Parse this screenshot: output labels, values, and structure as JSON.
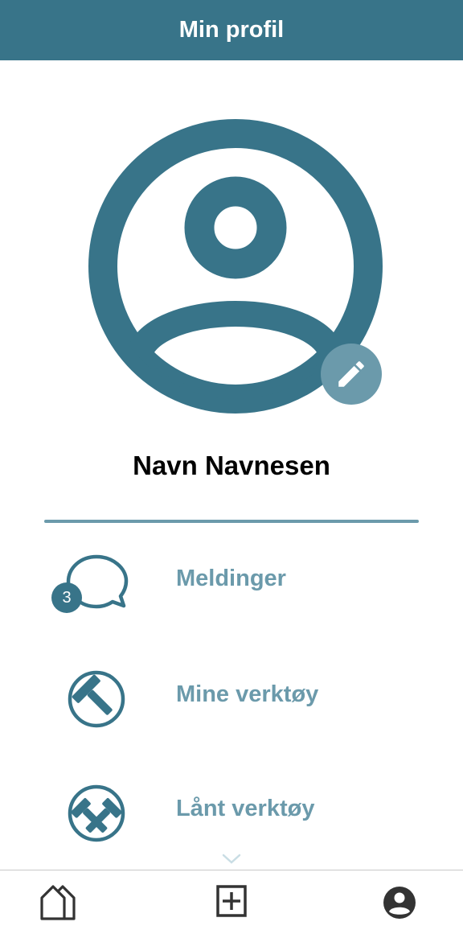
{
  "header": {
    "title": "Min profil"
  },
  "profile": {
    "name": "Navn Navnesen"
  },
  "menu": [
    {
      "label": "Meldinger",
      "icon": "chat-bubble-icon",
      "badge": "3"
    },
    {
      "label": "Mine verktøy",
      "icon": "hammer-icon"
    },
    {
      "label": "Lånt verktøy",
      "icon": "hammers-icon"
    }
  ],
  "colors": {
    "primary": "#387489",
    "accent": "#6b9aab",
    "text": "#000000",
    "nav_icon": "#333333"
  }
}
